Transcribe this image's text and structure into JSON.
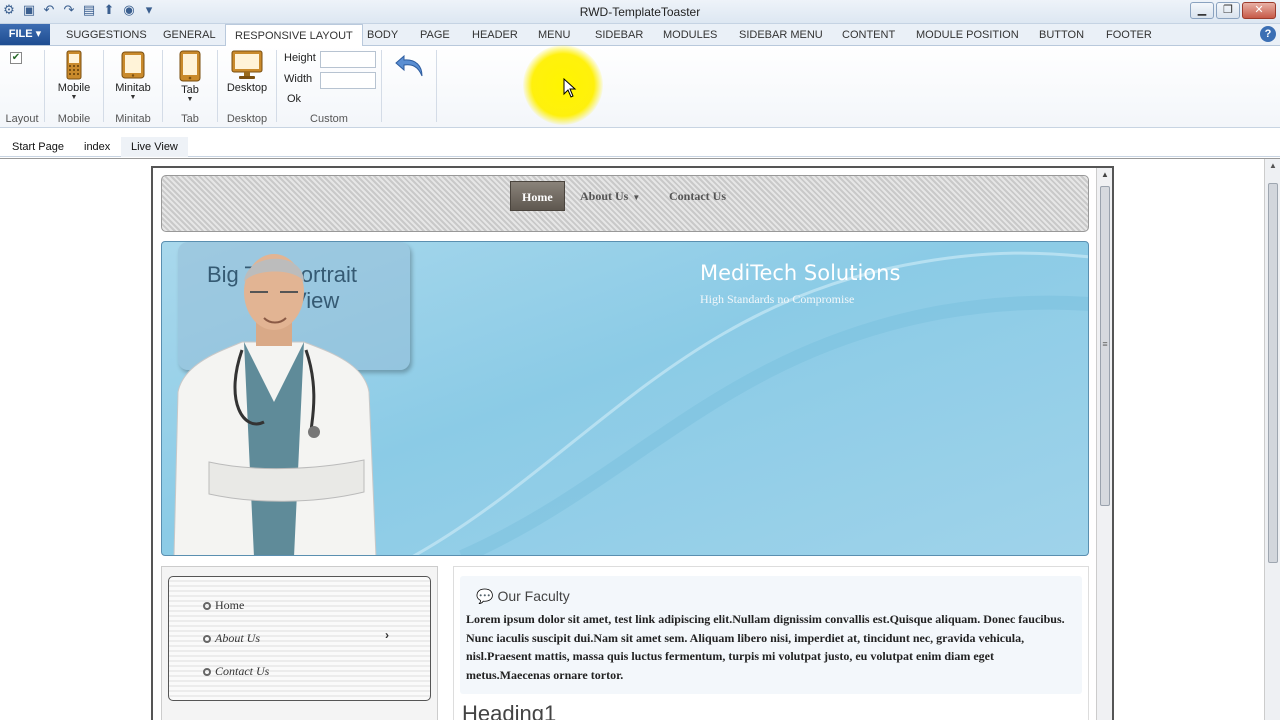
{
  "window": {
    "title": "RWD-TemplateToaster"
  },
  "ribbon_tabs": {
    "file": "FILE",
    "tabs": [
      "SUGGESTIONS",
      "GENERAL",
      "RESPONSIVE LAYOUT",
      "BODY",
      "PAGE",
      "HEADER",
      "MENU",
      "SIDEBAR",
      "MODULES",
      "SIDEBAR MENU",
      "CONTENT",
      "MODULE POSITION",
      "BUTTON",
      "FOOTER"
    ],
    "active": "RESPONSIVE LAYOUT"
  },
  "ribbon": {
    "layout_group": "Layout",
    "mobile_label": "Mobile",
    "mobile_group": "Mobile",
    "minitab_label": "Minitab",
    "minitab_group": "Minitab",
    "tab_label": "Tab",
    "tab_group": "Tab",
    "desktop_label": "Desktop",
    "desktop_group": "Desktop",
    "height_label": "Height",
    "width_label": "Width",
    "ok_label": "Ok",
    "custom_group": "Custom",
    "height_value": "",
    "width_value": ""
  },
  "doc_tabs": [
    "Start Page",
    "index",
    "Live View"
  ],
  "site": {
    "menu": {
      "home": "Home",
      "about": "About Us",
      "contact": "Contact Us"
    },
    "hero": {
      "overlay_text_line1": "Big Tab Portrait",
      "overlay_text_line2": "View",
      "company": "MediTech Solutions",
      "tagline": "High Standards no Compromise"
    },
    "sidebar_menu": [
      "Home",
      "About Us",
      "Contact Us"
    ],
    "content": {
      "title": "Our Faculty",
      "body": "Lorem ipsum dolor sit amet, test link adipiscing elit.Nullam dignissim convallis est.Quisque aliquam. Donec faucibus. Nunc iaculis suscipit dui.Nam sit amet sem. Aliquam libero nisi, imperdiet at, tincidunt nec, gravida vehicula, nisl.Praesent mattis, massa quis luctus fermentum, turpis mi volutpat justo, eu volutpat enim diam eget metus.Maecenas ornare tortor.",
      "heading1": "Heading1"
    }
  },
  "colors": {
    "accent": "#1f4d91",
    "hero": "#8bcbe6",
    "highlight": "#fff200"
  }
}
